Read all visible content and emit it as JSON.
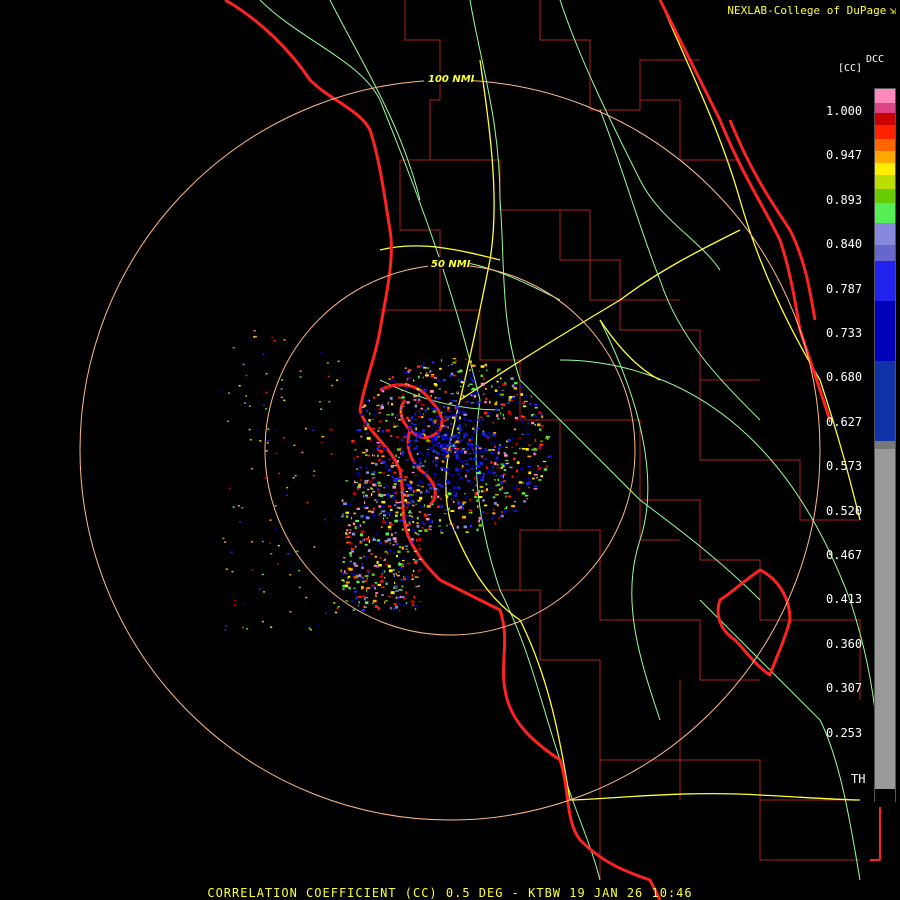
{
  "credit": {
    "text": "NEXLAB-College of DuPage",
    "icon": "box-arrow-icon"
  },
  "legend": {
    "unit_top": "DCC",
    "unit_bottom": "[CC]",
    "ticks": [
      "1.000",
      "0.947",
      "0.893",
      "0.840",
      "0.787",
      "0.733",
      "0.680",
      "0.627",
      "0.573",
      "0.520",
      "0.467",
      "0.413",
      "0.360",
      "0.307",
      "0.253"
    ],
    "th_label": "TH",
    "colors": [
      "#ff88bb",
      "#dd4488",
      "#cc0000",
      "#ff2200",
      "#ff6600",
      "#ffaa00",
      "#ffee00",
      "#bbdd00",
      "#66cc00",
      "#55ee55",
      "#8888dd",
      "#6666cc",
      "#2222ee",
      "#0000bb",
      "#1133aa",
      "#777777",
      "#999999",
      "#000000"
    ]
  },
  "range_rings": [
    {
      "label": "100 NMI"
    },
    {
      "label": "50 NMI"
    }
  ],
  "footer": "CORRELATION COEFFICIENT (CC) 0.5 DEG - KTBW 19 JAN 26 10:46",
  "colors": {
    "coast": "#ff2222",
    "county": "#aa2222",
    "highway": "#ffff33",
    "road": "#99ff99",
    "ring": "#ffbb88",
    "label": "#ffff33"
  }
}
